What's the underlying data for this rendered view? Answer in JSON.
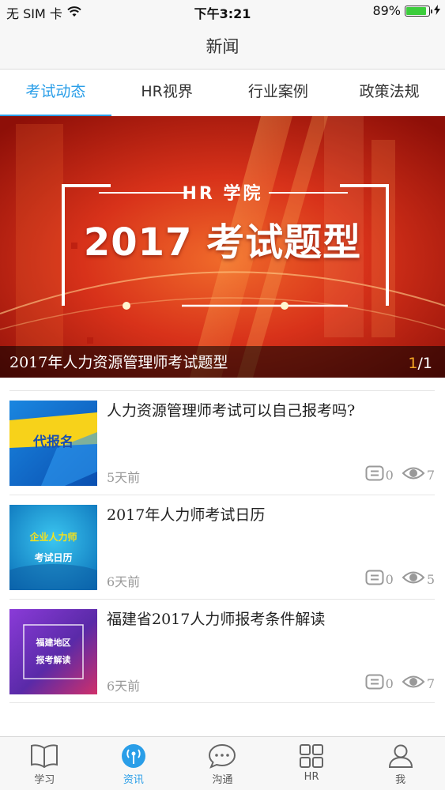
{
  "status_bar": {
    "carrier": "无 SIM 卡",
    "time": "下午3:21",
    "battery": "89%",
    "battery_level": 0.89
  },
  "nav": {
    "title": "新闻"
  },
  "tabs": [
    {
      "label": "考试动态",
      "active": true
    },
    {
      "label": "HR视界",
      "active": false
    },
    {
      "label": "行业案例",
      "active": false
    },
    {
      "label": "政策法规",
      "active": false
    }
  ],
  "banner": {
    "subtitle": "HR 学院",
    "headline": "2017 考试题型",
    "caption": "2017年人力资源管理师考试题型",
    "page_current": "1",
    "page_total": "/1"
  },
  "articles": [
    {
      "title": "人力资源管理师考试可以自己报考吗?",
      "thumb_text": "代报名",
      "time": "5天前",
      "comments": "0",
      "views": "7"
    },
    {
      "title": "2017年人力师考试日历",
      "thumb_text": "企业人力师",
      "thumb_text2": "考试日历",
      "time": "6天前",
      "comments": "0",
      "views": "5"
    },
    {
      "title": "福建省2017人力师报考条件解读",
      "thumb_text": "福建地区",
      "thumb_text2": "报考解读",
      "time": "6天前",
      "comments": "0",
      "views": "7"
    }
  ],
  "tab_bar": [
    {
      "label": "学习",
      "icon": "book-icon",
      "active": false
    },
    {
      "label": "资讯",
      "icon": "signal-icon",
      "active": true
    },
    {
      "label": "沟通",
      "icon": "chat-bubble-icon",
      "active": false
    },
    {
      "label": "HR",
      "icon": "grid-icon",
      "active": false
    },
    {
      "label": "我",
      "icon": "person-icon",
      "active": false
    }
  ],
  "colors": {
    "accent": "#2a9ee8",
    "banner_red": "#c0200d",
    "pager_highlight": "#f5a623"
  }
}
